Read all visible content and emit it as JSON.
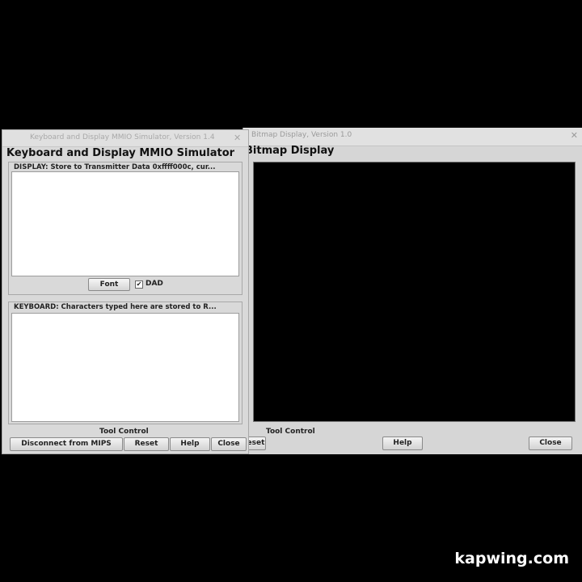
{
  "bitmap_window": {
    "title": "Bitmap Display, Version 1.0",
    "heading": "Bitmap Display",
    "tool_control_label": "Tool Control",
    "buttons": {
      "reset": "Reset",
      "help": "Help",
      "close": "Close"
    },
    "canvas_color": "#000000"
  },
  "mmio_window": {
    "title": "Keyboard and Display MMIO Simulator, Version 1.4",
    "heading": "Keyboard and Display MMIO Simulator",
    "display_panel": {
      "caption": "DISPLAY: Store to Transmitter Data 0xffff000c, cur...",
      "font_button": "Font",
      "dad_label": "DAD",
      "dad_checked": true
    },
    "keyboard_panel": {
      "caption": "KEYBOARD: Characters typed here are stored to R..."
    },
    "tool_control_label": "Tool Control",
    "buttons": {
      "disconnect": "Disconnect from MIPS",
      "reset": "Reset",
      "help": "Help",
      "close": "Close"
    }
  },
  "watermark": "kapwing.com"
}
